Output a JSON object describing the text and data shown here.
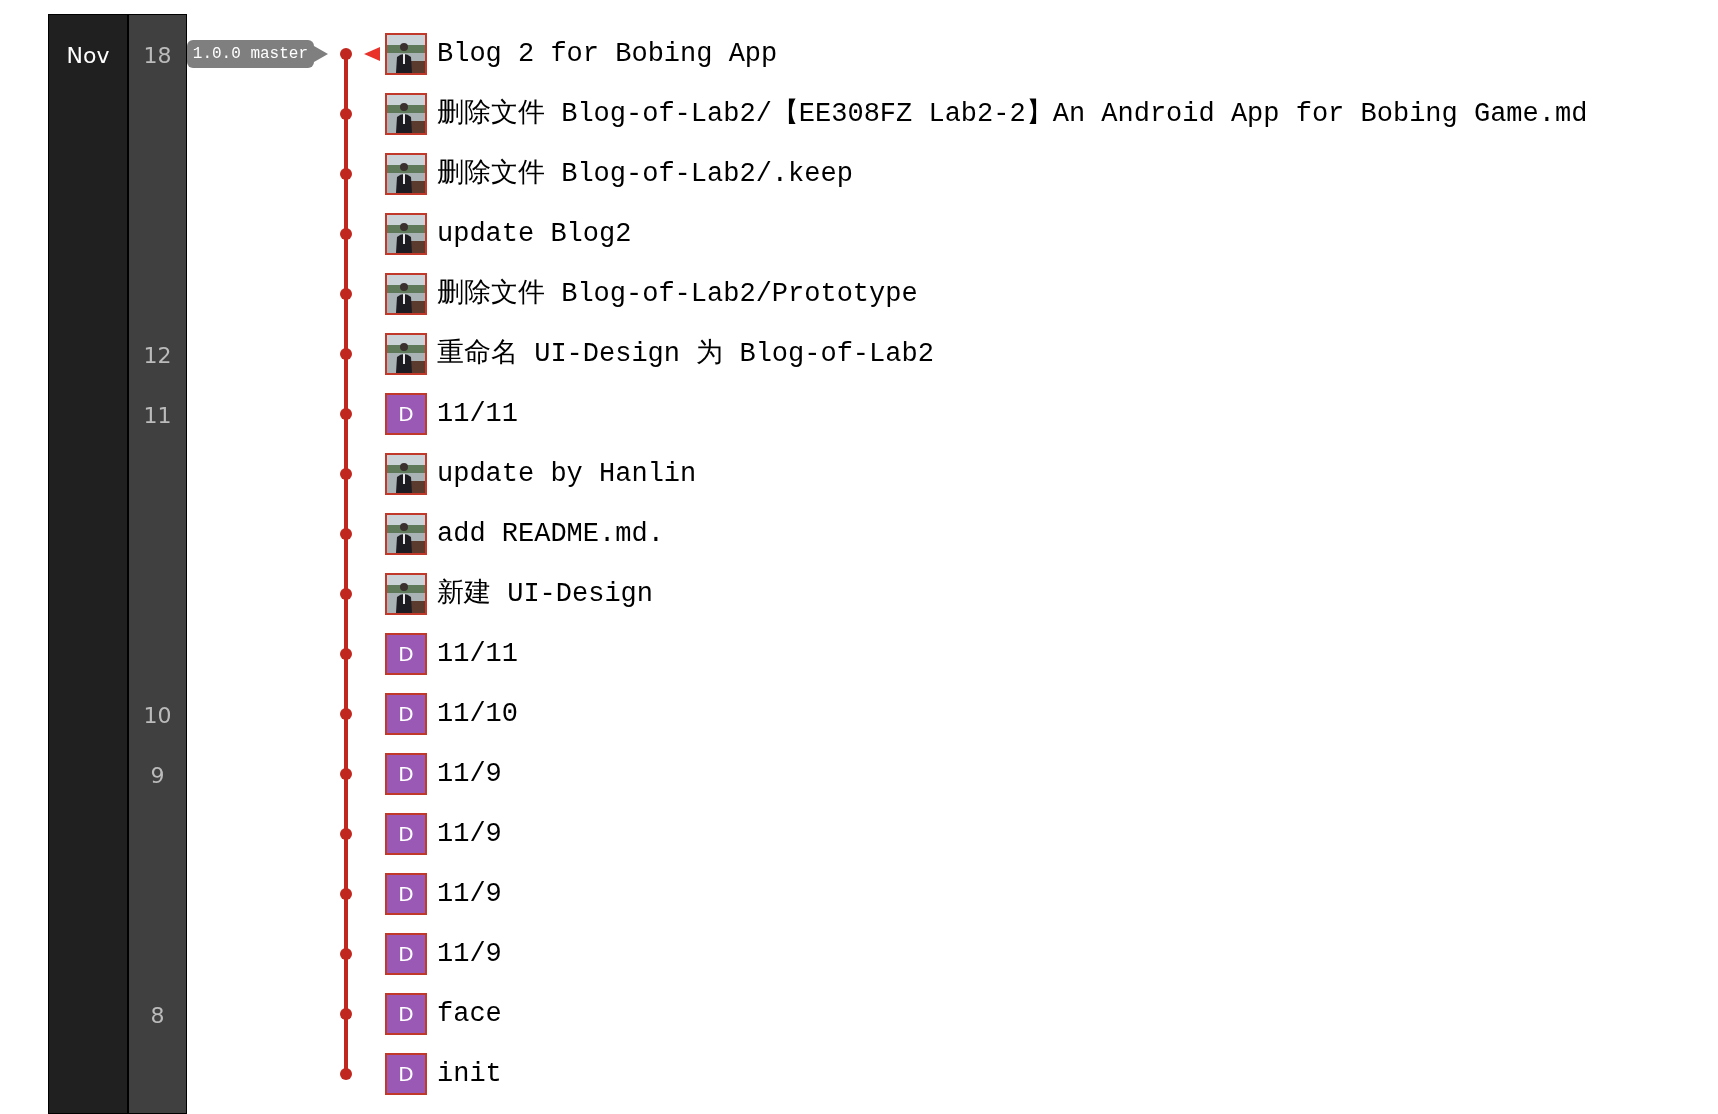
{
  "month": "Nov",
  "refs": "1.0.0 master",
  "commits": [
    {
      "day": "18",
      "head": true,
      "message": "Blog 2 for Bobing App"
    },
    {
      "head": false,
      "message": "删除文件 Blog-of-Lab2/【EE308FZ Lab2-2】An Android App for Bobing Game.md"
    },
    {
      "head": false,
      "message": "删除文件 Blog-of-Lab2/.keep"
    },
    {
      "head": false,
      "message": "update Blog2"
    },
    {
      "head": false,
      "message": "删除文件 Blog-of-Lab2/Prototype"
    },
    {
      "day": "12",
      "head": false,
      "message": "重命名 UI-Design 为 Blog-of-Lab2"
    },
    {
      "day": "11",
      "head": false,
      "avatar": {
        "kind": "letter",
        "letter": "D"
      },
      "message": "11/11"
    },
    {
      "head": false,
      "message": "update by Hanlin"
    },
    {
      "head": false,
      "message": "add README.md."
    },
    {
      "head": false,
      "message": "新建 UI-Design"
    },
    {
      "head": false,
      "avatar": {
        "kind": "letter",
        "letter": "D"
      },
      "message": "11/11"
    },
    {
      "day": "10",
      "head": false,
      "avatar": {
        "kind": "letter",
        "letter": "D"
      },
      "message": "11/10"
    },
    {
      "day": "9",
      "head": false,
      "avatar": {
        "kind": "letter",
        "letter": "D"
      },
      "message": "11/9"
    },
    {
      "head": false,
      "avatar": {
        "kind": "letter",
        "letter": "D"
      },
      "message": "11/9"
    },
    {
      "head": false,
      "avatar": {
        "kind": "letter",
        "letter": "D"
      },
      "message": "11/9"
    },
    {
      "head": false,
      "avatar": {
        "kind": "letter",
        "letter": "D"
      },
      "message": "11/9"
    },
    {
      "day": "8",
      "head": false,
      "avatar": {
        "kind": "letter",
        "letter": "D"
      },
      "message": "face"
    },
    {
      "head": false,
      "avatar": {
        "kind": "letter",
        "letter": "D"
      },
      "message": "init"
    }
  ]
}
